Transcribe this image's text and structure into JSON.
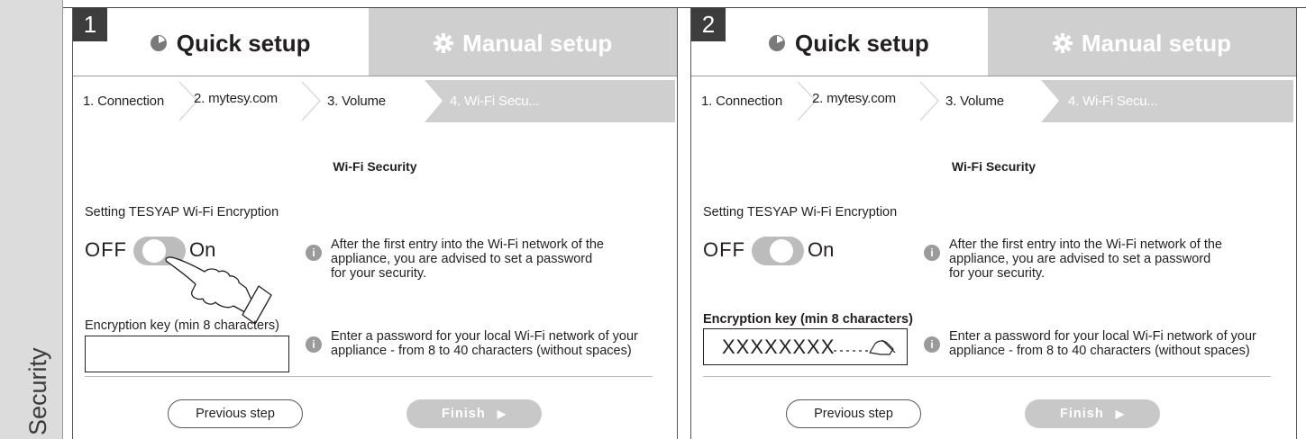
{
  "side_label": "Security",
  "panels": [
    {
      "number": "1",
      "tabs": {
        "quick": "Quick setup",
        "manual": "Manual setup"
      },
      "steps": [
        "1. Connection",
        "2. mytesy.com",
        "3. Volume",
        "4. Wi-Fi Secu..."
      ],
      "section_title": "Wi-Fi Security",
      "encryption_label": "Setting TESYAP Wi-Fi Encryption",
      "toggle": {
        "off_label": "OFF",
        "on_label": "On"
      },
      "info1": {
        "line1": "After the first entry into the Wi-Fi network of the",
        "line2": "appliance, you are advised to set a password",
        "line3": "for your security."
      },
      "key_label": "Encryption key (min 8 characters)",
      "key_value": "",
      "info2": {
        "line1": "Enter a password for your local Wi-Fi network of your",
        "line2": "appliance - from 8 to 40 characters (without spaces)"
      },
      "prev_button": "Previous step",
      "finish_button": "Finish"
    },
    {
      "number": "2",
      "tabs": {
        "quick": "Quick setup",
        "manual": "Manual setup"
      },
      "steps": [
        "1. Connection",
        "2. mytesy.com",
        "3. Volume",
        "4. Wi-Fi Secu..."
      ],
      "section_title": "Wi-Fi Security",
      "encryption_label": "Setting TESYAP Wi-Fi Encryption",
      "toggle": {
        "off_label": "OFF",
        "on_label": "On"
      },
      "info1": {
        "line1": "After the first entry into the Wi-Fi network of the",
        "line2": "appliance, you are advised to set a password",
        "line3": "for your security."
      },
      "key_label": "Encryption key (min 8 characters)",
      "key_value": "XXXXXXXX",
      "info2": {
        "line1": "Enter a password for your local Wi-Fi network of your",
        "line2": "appliance - from 8 to 40 characters (without spaces)"
      },
      "prev_button": "Previous step",
      "finish_button": "Finish"
    }
  ],
  "icons": {
    "quick": "clock-icon",
    "manual": "gear-icon",
    "info": "info-icon",
    "finish": "play-arrow-icon",
    "hand": "pointing-hand-icon",
    "pencil": "writing-hand-icon"
  },
  "colors": {
    "active_step": "#cfcfcf",
    "manual_tab": "#cfcfcf",
    "finish_button": "#c8c8c8",
    "badge": "#3d3d3d"
  }
}
